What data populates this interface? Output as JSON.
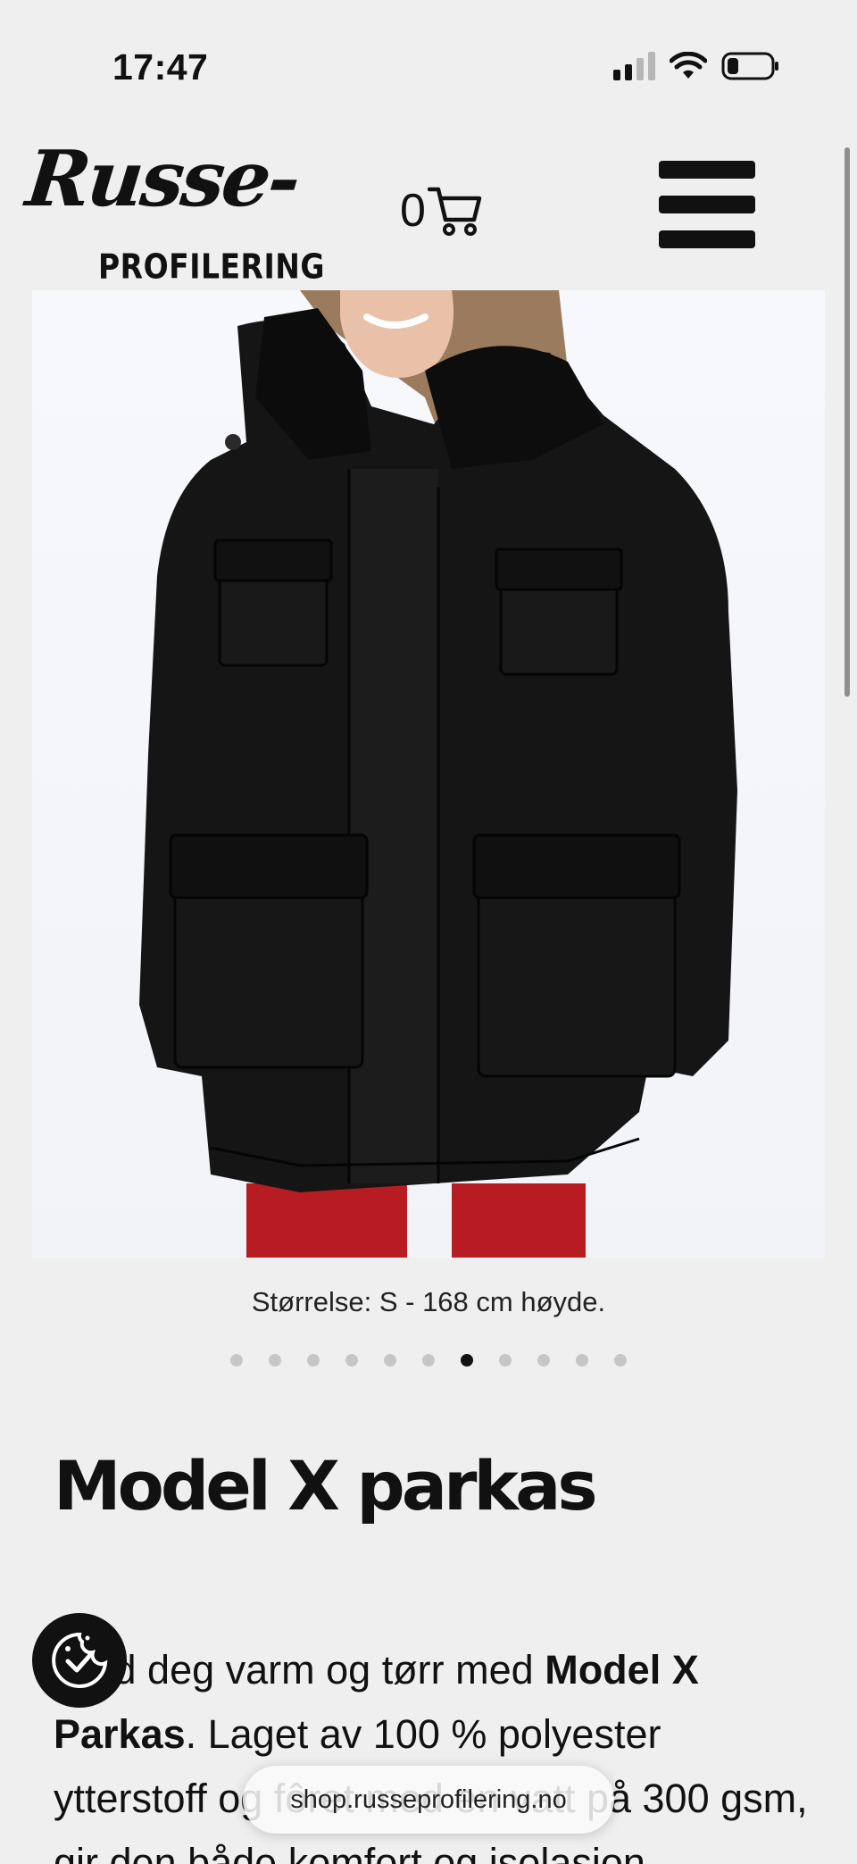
{
  "status_bar": {
    "time": "17:47",
    "signal_icon": "cellular-signal-icon",
    "wifi_icon": "wifi-icon",
    "battery_icon": "battery-low-icon"
  },
  "header": {
    "logo_script": "Russe-",
    "logo_sub": "PROFILERING",
    "cart_count": "0",
    "cart_icon": "shopping-cart-icon",
    "menu_icon": "hamburger-menu-icon"
  },
  "gallery": {
    "image_alt": "Model X parkas, black jacket",
    "caption": "Størrelse: S - 168 cm høyde.",
    "slide_count": 11,
    "active_slide": 7
  },
  "product": {
    "title": "Model X parkas",
    "desc_part1": "Hold deg varm og tørr med ",
    "desc_bold1": "Model X Parkas",
    "desc_part2": ". Laget av 100 % polyester ytterstoff og fôret med en vatt på 300 gsm, gir den både komfort og isolasjon"
  },
  "floating": {
    "cookie_icon": "cookie-consent-icon",
    "url": "shop.russeprofilering.no"
  },
  "colors": {
    "background": "#efefef",
    "text": "#111111",
    "dot_inactive": "#c6c6c6",
    "dot_active": "#111111"
  }
}
